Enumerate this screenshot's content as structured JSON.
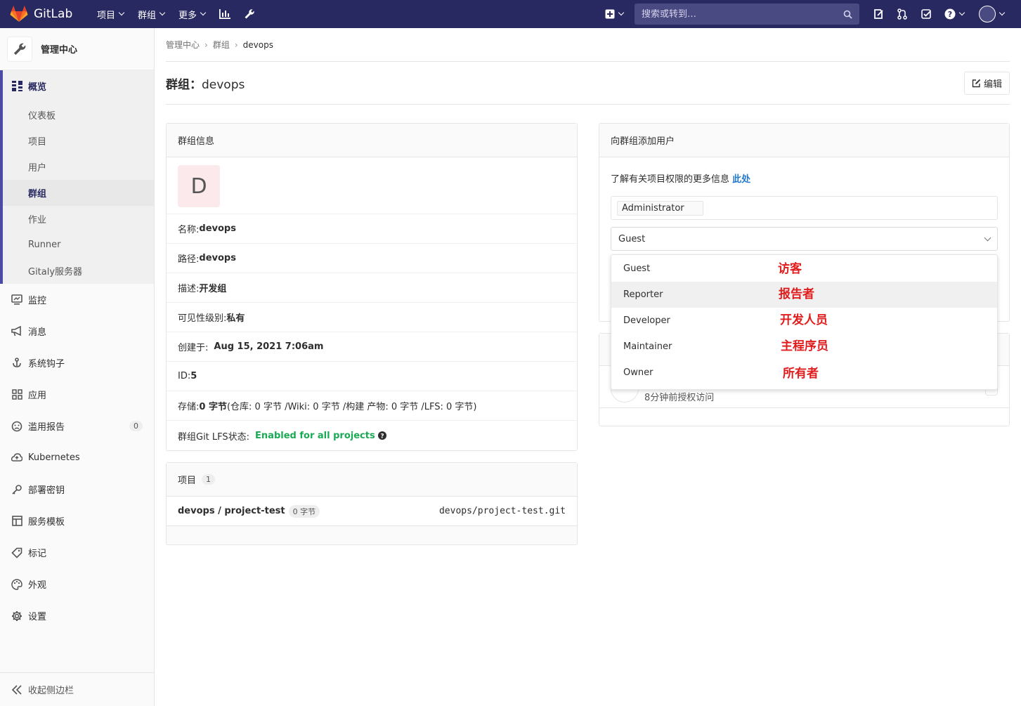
{
  "navbar": {
    "brand": "GitLab",
    "menu": [
      {
        "label": "项目"
      },
      {
        "label": "群组"
      },
      {
        "label": "更多"
      }
    ],
    "search_placeholder": "搜索或转到…"
  },
  "sidebar": {
    "title": "管理中心",
    "overview": {
      "label": "概览",
      "items": [
        "仪表板",
        "项目",
        "用户",
        "群组",
        "作业",
        "Runner",
        "Gitaly服务器"
      ]
    },
    "items": [
      {
        "label": "监控",
        "icon": "monitor-icon"
      },
      {
        "label": "消息",
        "icon": "bullhorn-icon"
      },
      {
        "label": "系统钩子",
        "icon": "hook-icon"
      },
      {
        "label": "应用",
        "icon": "applications-icon"
      },
      {
        "label": "滥用报告",
        "icon": "abuse-icon",
        "badge": "0"
      },
      {
        "label": "Kubernetes",
        "icon": "kubernetes-icon"
      },
      {
        "label": "部署密钥",
        "icon": "key-icon"
      },
      {
        "label": "服务模板",
        "icon": "template-icon"
      },
      {
        "label": "标记",
        "icon": "label-icon"
      },
      {
        "label": "外观",
        "icon": "appearance-icon"
      },
      {
        "label": "设置",
        "icon": "settings-icon"
      }
    ],
    "collapse_label": "收起侧边栏"
  },
  "breadcrumb": [
    "管理中心",
    "群组",
    "devops"
  ],
  "page": {
    "title_prefix": "群组：",
    "title_name": "devops",
    "edit_label": "编辑"
  },
  "group_info": {
    "header": "群组信息",
    "avatar_letter": "D",
    "rows": {
      "name_label": "名称: ",
      "name_value": "devops",
      "path_label": "路径: ",
      "path_value": "devops",
      "desc_label": "描述: ",
      "desc_value": "开发组",
      "vis_label": "可见性级别: ",
      "vis_value": "私有",
      "created_label": "创建于: ",
      "created_value": "Aug 15, 2021 7:06am",
      "id_label": "ID: ",
      "id_value": "5",
      "storage_label": "存储: ",
      "storage_value": "0 字节",
      "storage_detail": " (仓库: 0 字节 /Wiki: 0 字节 /构建 产物: 0 字节 /LFS: 0 字节)",
      "lfs_label": "群组Git LFS状态: ",
      "lfs_value": "Enabled for all projects"
    }
  },
  "projects": {
    "header": "项目",
    "count": "1",
    "item_name": "devops / project-test",
    "item_size": "0 字节",
    "item_path": "devops/project-test.git"
  },
  "add_user": {
    "header": "向群组添加用户",
    "info_text": "了解有关项目权限的更多信息 ",
    "info_link": "此处",
    "selected_user": "Administrator",
    "role_value": "Guest",
    "options": [
      {
        "label": "Guest",
        "note": "访客"
      },
      {
        "label": "Reporter",
        "note": "报告者"
      },
      {
        "label": "Developer",
        "note": "开发人员"
      },
      {
        "label": "Maintainer",
        "note": "主程序员"
      },
      {
        "label": "Owner",
        "note": "所有者"
      }
    ]
  },
  "members": {
    "access_text": "8分钟前授权访问"
  },
  "colors": {
    "navbar": "#292961",
    "accent": "#4b4ba3",
    "success": "#1aaa55",
    "link": "#1f78d1",
    "annotation": "#e01c1c"
  }
}
